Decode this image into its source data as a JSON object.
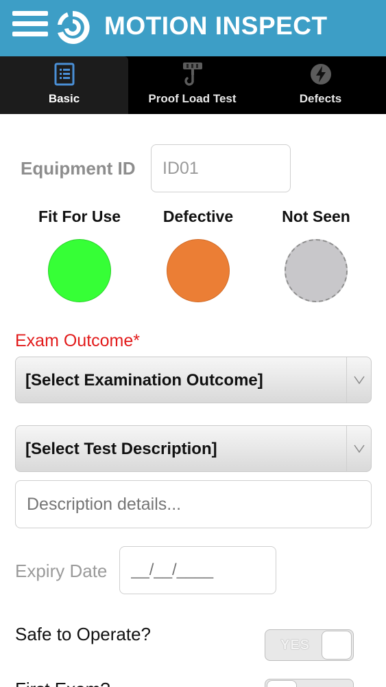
{
  "header": {
    "title": "MOTION INSPECT",
    "background_color": "#3d9ec6"
  },
  "tabs": [
    {
      "label": "Basic",
      "icon": "document-icon",
      "active": true
    },
    {
      "label": "Proof Load Test",
      "icon": "hook-icon",
      "active": false
    },
    {
      "label": "Defects",
      "icon": "lightning-icon",
      "active": false
    }
  ],
  "form": {
    "equipment_id_label": "Equipment ID",
    "equipment_id_value": "ID01",
    "status_options": [
      {
        "label": "Fit For Use",
        "color": "#36ff36"
      },
      {
        "label": "Defective",
        "color": "#eb7e35"
      },
      {
        "label": "Not Seen",
        "color": "#c8c7ca"
      }
    ],
    "exam_outcome_label": "Exam Outcome*",
    "exam_outcome_select": "[Select Examination Outcome]",
    "test_description_select": "[Select Test Description]",
    "description_placeholder": "Description details...",
    "expiry_date_label": "Expiry Date",
    "expiry_date_placeholder": "__/__/____",
    "safe_to_operate_label": "Safe to Operate?",
    "safe_to_operate_toggle": "YES",
    "first_exam_label": "First Exam?"
  }
}
